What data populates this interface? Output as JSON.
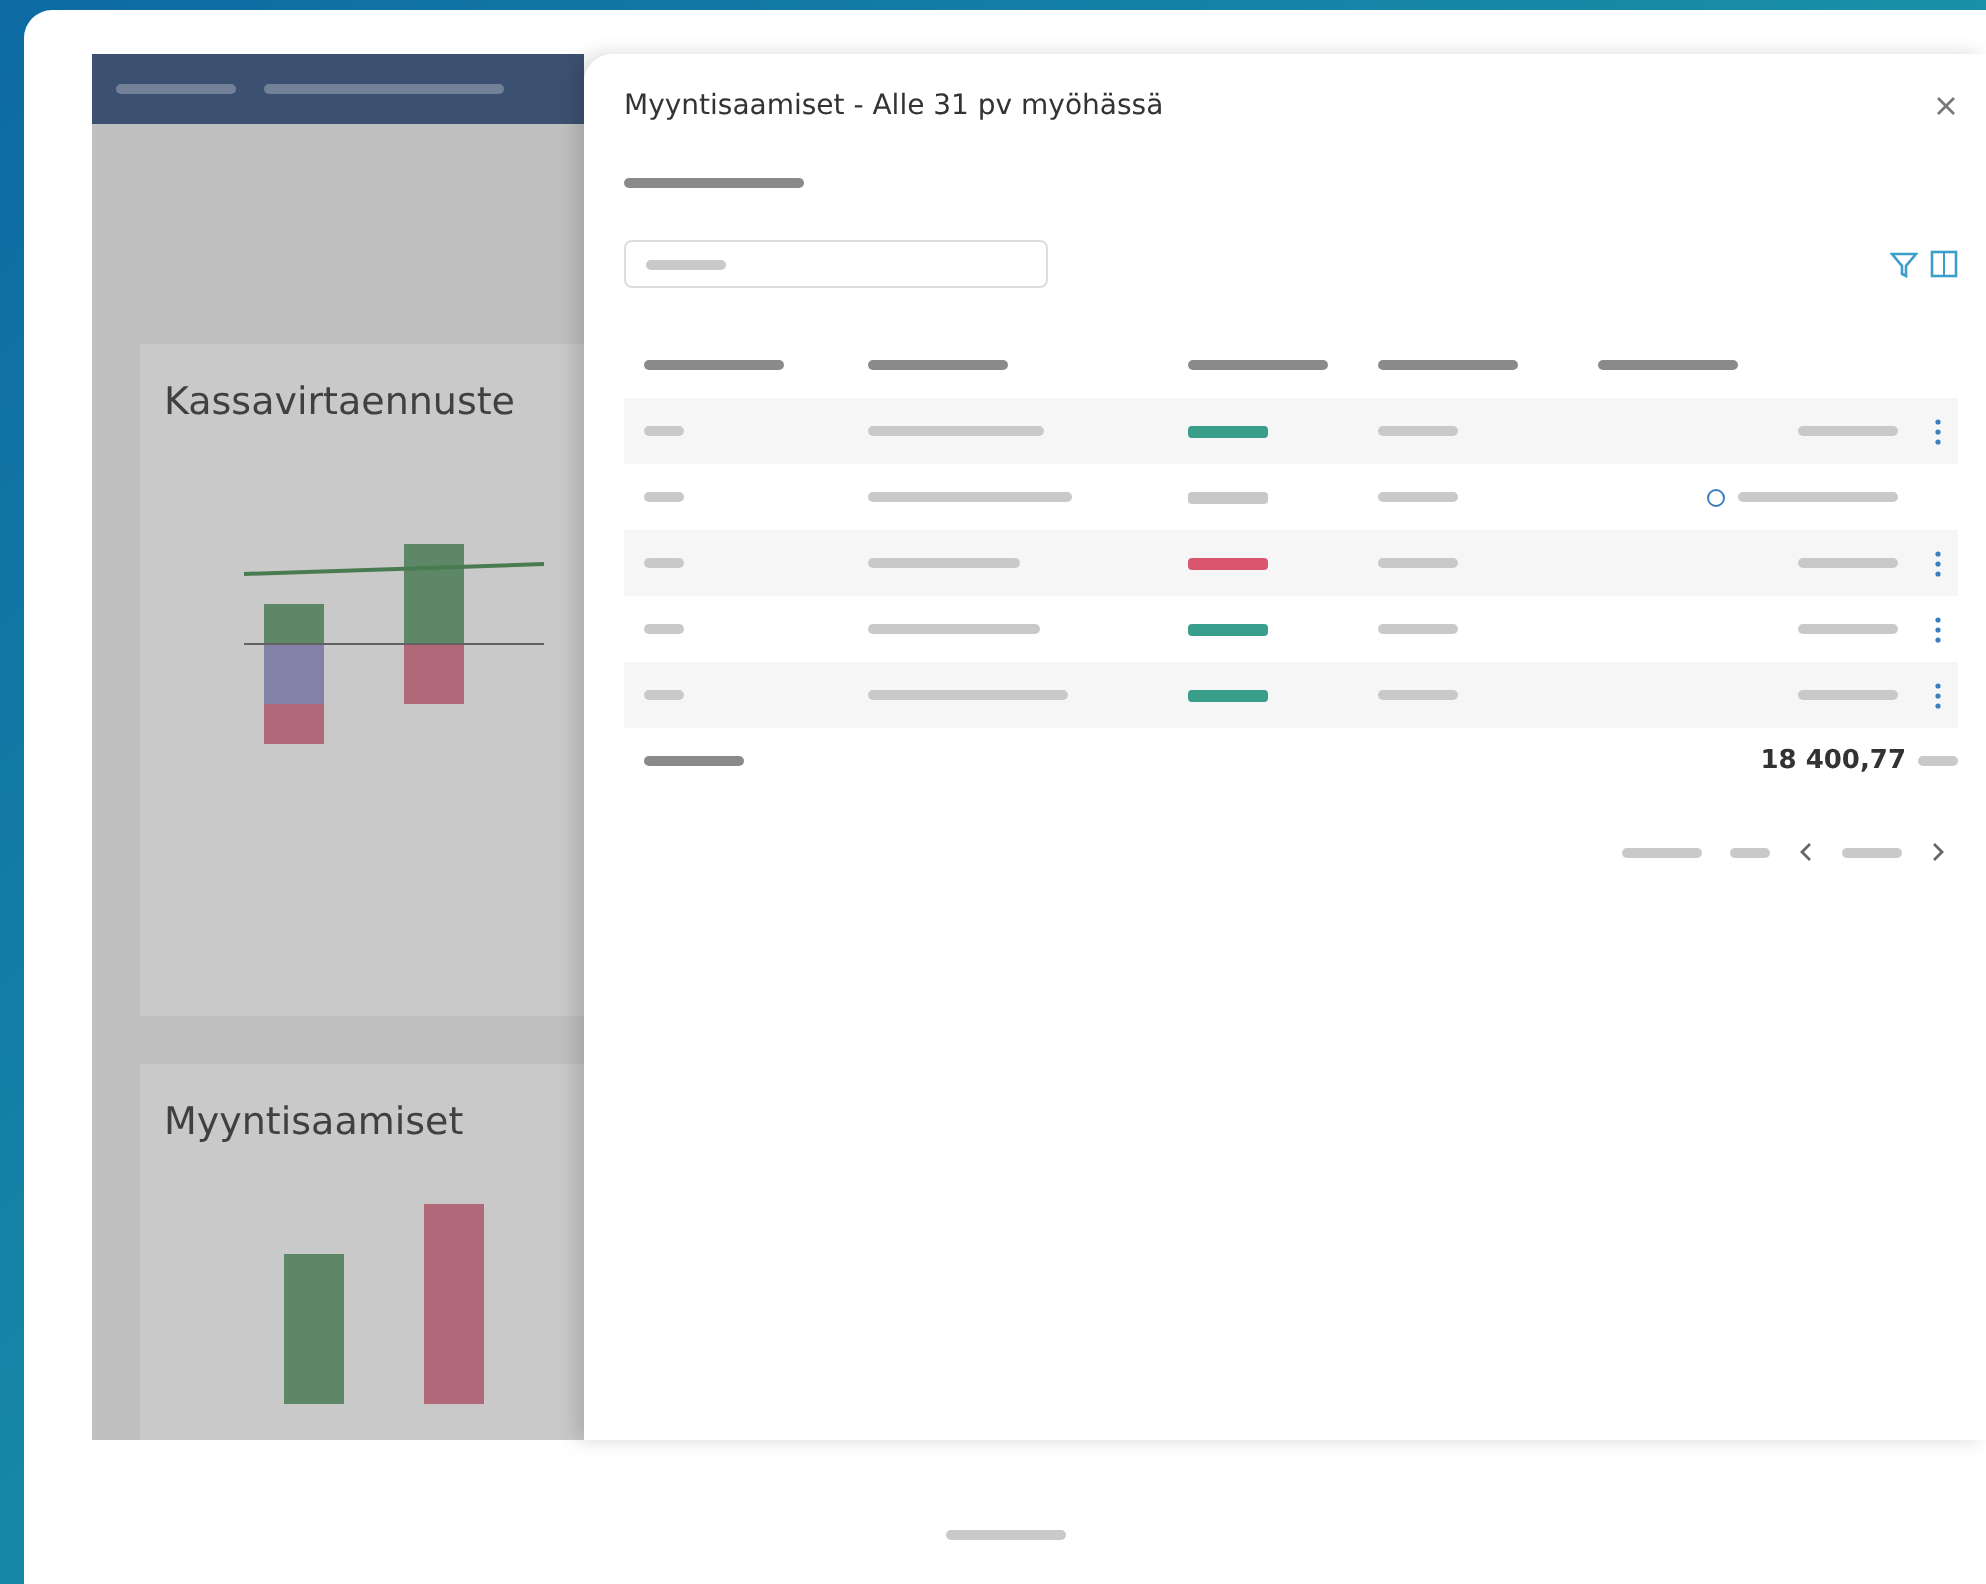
{
  "background_app": {
    "cards": [
      {
        "title": "Kassavirtaennuste",
        "kind": "forecast"
      },
      {
        "title": "Myyntisaamiset",
        "kind": "receivables"
      }
    ]
  },
  "modal": {
    "title": "Myyntisaamiset - Alle 31 pv myöhässä",
    "rows": [
      {
        "color": "#3a9e8c",
        "kind": "amount"
      },
      {
        "color": "#c8c8c8",
        "kind": "note"
      },
      {
        "color": "#d9566e",
        "kind": "amount"
      },
      {
        "color": "#3a9e8c",
        "kind": "amount"
      },
      {
        "color": "#3a9e8c",
        "kind": "amount"
      }
    ],
    "total": {
      "value": "18 400,77"
    }
  }
}
